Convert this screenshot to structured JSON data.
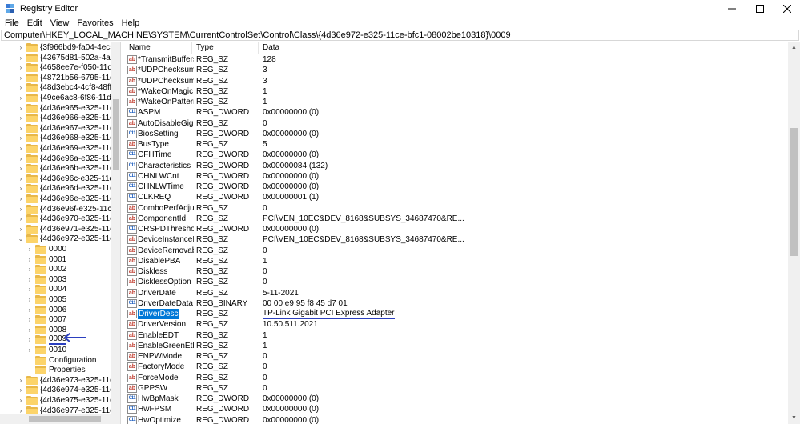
{
  "window": {
    "title": "Registry Editor",
    "controls": {
      "minimize": "–",
      "maximize": "☐",
      "close": "✕"
    }
  },
  "menu": [
    "File",
    "Edit",
    "View",
    "Favorites",
    "Help"
  ],
  "address": "Computer\\HKEY_LOCAL_MACHINE\\SYSTEM\\CurrentControlSet\\Control\\Class\\{4d36e972-e325-11ce-bfc1-08002be10318}\\0009",
  "tree": {
    "keys_before": [
      "{3f966bd9-fa04-4ec5-991",
      "{43675d81-502a-4a82-9f8",
      "{4658ee7e-f050-11d1-b6b",
      "{48721b56-6795-11d2-b1",
      "{48d3ebc4-4cf8-48ff-b86",
      "{49ce6ac8-6f86-11d2-b1e",
      "{4d36e965-e325-11ce-bfc",
      "{4d36e966-e325-11ce-bfc",
      "{4d36e967-e325-11ce-bfc",
      "{4d36e968-e325-11ce-bfc",
      "{4d36e969-e325-11ce-bfc",
      "{4d36e96a-e325-11ce-bfc",
      "{4d36e96b-e325-11ce-bfc",
      "{4d36e96c-e325-11ce-bfc",
      "{4d36e96d-e325-11ce-bfc",
      "{4d36e96e-e325-11ce-bfc",
      "{4d36e96f-e325-11ce-bfc",
      "{4d36e970-e325-11ce-bfc",
      "{4d36e971-e325-11ce-bfc"
    ],
    "expanded_key": "{4d36e972-e325-11ce-bfc",
    "children": [
      "0000",
      "0001",
      "0002",
      "0003",
      "0004",
      "0005",
      "0006",
      "0007",
      "0008",
      "0009",
      "0010",
      "Configuration",
      "Properties"
    ],
    "selected_child": "0009",
    "keys_after": [
      "{4d36e973-e325-11ce-bfc",
      "{4d36e974-e325-11ce-bfc",
      "{4d36e975-e325-11ce-bfc",
      "{4d36e977-e325-11ce-bfc"
    ]
  },
  "columns": {
    "name": "Name",
    "type": "Type",
    "data": "Data"
  },
  "values": [
    {
      "icon": "ab",
      "name": "*TransmitBuffers",
      "type": "REG_SZ",
      "data": "128"
    },
    {
      "icon": "ab",
      "name": "*UDPChecksum...",
      "type": "REG_SZ",
      "data": "3"
    },
    {
      "icon": "ab",
      "name": "*UDPChecksum...",
      "type": "REG_SZ",
      "data": "3"
    },
    {
      "icon": "ab",
      "name": "*WakeOnMagic...",
      "type": "REG_SZ",
      "data": "1"
    },
    {
      "icon": "ab",
      "name": "*WakeOnPattern",
      "type": "REG_SZ",
      "data": "1"
    },
    {
      "icon": "bin",
      "name": "ASPM",
      "type": "REG_DWORD",
      "data": "0x00000000 (0)"
    },
    {
      "icon": "ab",
      "name": "AutoDisableGig...",
      "type": "REG_SZ",
      "data": "0"
    },
    {
      "icon": "bin",
      "name": "BiosSetting",
      "type": "REG_DWORD",
      "data": "0x00000000 (0)"
    },
    {
      "icon": "ab",
      "name": "BusType",
      "type": "REG_SZ",
      "data": "5"
    },
    {
      "icon": "bin",
      "name": "CFHTime",
      "type": "REG_DWORD",
      "data": "0x00000000 (0)"
    },
    {
      "icon": "bin",
      "name": "Characteristics",
      "type": "REG_DWORD",
      "data": "0x00000084 (132)"
    },
    {
      "icon": "bin",
      "name": "CHNLWCnt",
      "type": "REG_DWORD",
      "data": "0x00000000 (0)"
    },
    {
      "icon": "bin",
      "name": "CHNLWTime",
      "type": "REG_DWORD",
      "data": "0x00000000 (0)"
    },
    {
      "icon": "bin",
      "name": "CLKREQ",
      "type": "REG_DWORD",
      "data": "0x00000001 (1)"
    },
    {
      "icon": "ab",
      "name": "ComboPerfAdjust",
      "type": "REG_SZ",
      "data": "0"
    },
    {
      "icon": "ab",
      "name": "ComponentId",
      "type": "REG_SZ",
      "data": "PCI\\VEN_10EC&DEV_8168&SUBSYS_34687470&RE..."
    },
    {
      "icon": "bin",
      "name": "CRSPDThreshold",
      "type": "REG_DWORD",
      "data": "0x00000000 (0)"
    },
    {
      "icon": "ab",
      "name": "DeviceInstanceID",
      "type": "REG_SZ",
      "data": "PCI\\VEN_10EC&DEV_8168&SUBSYS_34687470&RE..."
    },
    {
      "icon": "ab",
      "name": "DeviceRemovable",
      "type": "REG_SZ",
      "data": "0"
    },
    {
      "icon": "ab",
      "name": "DisablePBA",
      "type": "REG_SZ",
      "data": "1"
    },
    {
      "icon": "ab",
      "name": "Diskless",
      "type": "REG_SZ",
      "data": "0"
    },
    {
      "icon": "ab",
      "name": "DisklessOption",
      "type": "REG_SZ",
      "data": "0"
    },
    {
      "icon": "ab",
      "name": "DriverDate",
      "type": "REG_SZ",
      "data": "5-11-2021"
    },
    {
      "icon": "bin",
      "name": "DriverDateData",
      "type": "REG_BINARY",
      "data": "00 00 e9 95 f8 45 d7 01"
    },
    {
      "icon": "ab",
      "name": "DriverDesc",
      "type": "REG_SZ",
      "data": "TP-Link Gigabit PCI Express Adapter",
      "selected": true
    },
    {
      "icon": "ab",
      "name": "DriverVersion",
      "type": "REG_SZ",
      "data": "10.50.511.2021"
    },
    {
      "icon": "ab",
      "name": "EnableEDT",
      "type": "REG_SZ",
      "data": "1"
    },
    {
      "icon": "ab",
      "name": "EnableGreenEth...",
      "type": "REG_SZ",
      "data": "1"
    },
    {
      "icon": "ab",
      "name": "ENPWMode",
      "type": "REG_SZ",
      "data": "0"
    },
    {
      "icon": "ab",
      "name": "FactoryMode",
      "type": "REG_SZ",
      "data": "0"
    },
    {
      "icon": "ab",
      "name": "ForceMode",
      "type": "REG_SZ",
      "data": "0"
    },
    {
      "icon": "ab",
      "name": "GPPSW",
      "type": "REG_SZ",
      "data": "0"
    },
    {
      "icon": "bin",
      "name": "HwBpMask",
      "type": "REG_DWORD",
      "data": "0x00000000 (0)"
    },
    {
      "icon": "bin",
      "name": "HwFPSM",
      "type": "REG_DWORD",
      "data": "0x00000000 (0)"
    },
    {
      "icon": "bin",
      "name": "HwOptimize",
      "type": "REG_DWORD",
      "data": "0x00000000 (0)"
    }
  ],
  "colors": {
    "selection": "#0078d7",
    "annotation": "#2b3fbf",
    "folder": "#fcd46a"
  }
}
